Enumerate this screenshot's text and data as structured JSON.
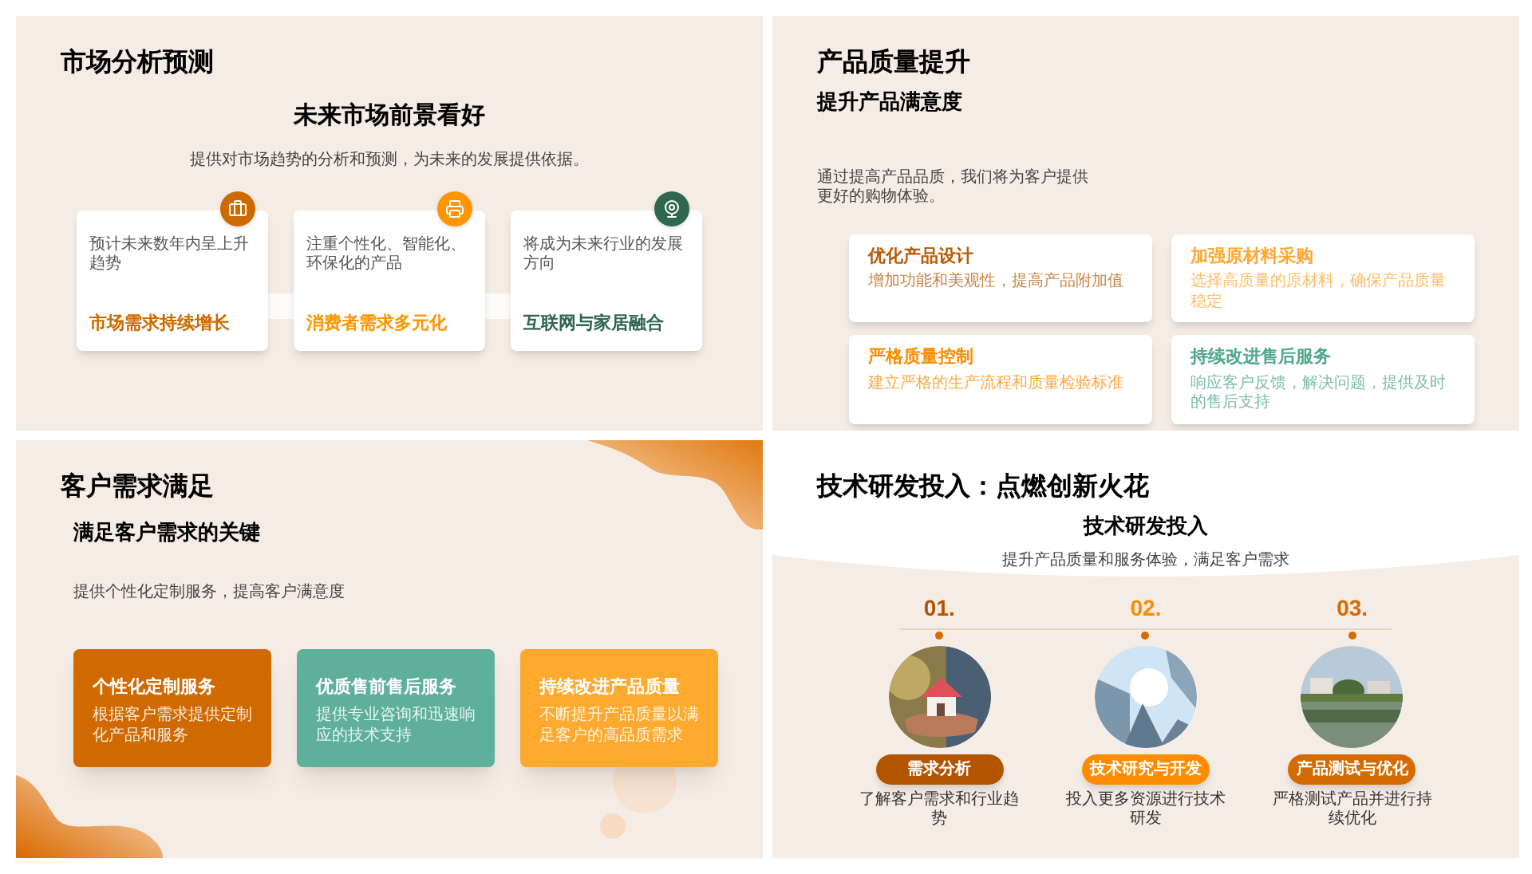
{
  "slides": [
    {
      "kind": "forecast",
      "title": "市场分析预测",
      "heading": "未来市场前景看好",
      "subtitle": "提供对市场趋势的分析和预测，为未来的发展提供依据。",
      "cards": [
        {
          "description": "预计未来数年内呈上升趋势",
          "label": "市场需求持续增长",
          "color": "#cc6a00"
        },
        {
          "description": "注重个性化、智能化、环保化的产品",
          "label": "消费者需求多元化",
          "color": "#ff9500"
        },
        {
          "description": "将成为未来行业的发展方向",
          "label": "互联网与家居融合",
          "color": "#2f6650"
        }
      ]
    },
    {
      "kind": "quality",
      "title": "产品质量提升",
      "heading": "提升产品满意度",
      "intro": "通过提高产品品质，我们将为客户提供更好的购物体验。",
      "cards": [
        {
          "title": "优化产品设计",
          "description": "增加功能和美观性，提高产品附加值",
          "color": "#b85c0a"
        },
        {
          "title": "加强原材料采购",
          "description": "选择高质量的原材料，确保产品质量稳定",
          "color": "#ffa733"
        },
        {
          "title": "严格质量控制",
          "description": "建立严格的生产流程和质量检验标准",
          "color": "#ff8c00"
        },
        {
          "title": "持续改进售后服务",
          "description": "响应客户反馈，解决问题，提供及时的售后支持",
          "color": "#4fa98a"
        }
      ]
    },
    {
      "kind": "needs",
      "title": "客户需求满足",
      "heading": "满足客户需求的关键",
      "intro": "提供个性化定制服务，提高客户满意度",
      "cards": [
        {
          "title": "个性化定制服务",
          "description": "根据客户需求提供定制化产品和服务",
          "color": "#d06a00"
        },
        {
          "title": "优质售前售后服务",
          "description": "提供专业咨询和迅速响应的技术支持",
          "color": "#5eb09a"
        },
        {
          "title": "持续改进产品质量",
          "description": "不断提升产品质量以满足客户的高品质需求",
          "color": "#ffaa2e"
        }
      ]
    },
    {
      "kind": "tech",
      "title": "技术研发投入：点燃创新火花",
      "heading": "技术研发投入",
      "subtitle": "提升产品质量和服务体验，满足客户需求",
      "steps": [
        {
          "number": "01.",
          "label": "需求分析",
          "description": "了解客户需求和行业趋势",
          "color": "#b35400"
        },
        {
          "number": "02.",
          "label": "技术研究与开发",
          "description": "投入更多资源进行技术研发",
          "color": "#ff8c00"
        },
        {
          "number": "03.",
          "label": "产品测试与优化",
          "description": "严格测试产品并进行持续优化",
          "color": "#d46a00"
        }
      ]
    }
  ]
}
